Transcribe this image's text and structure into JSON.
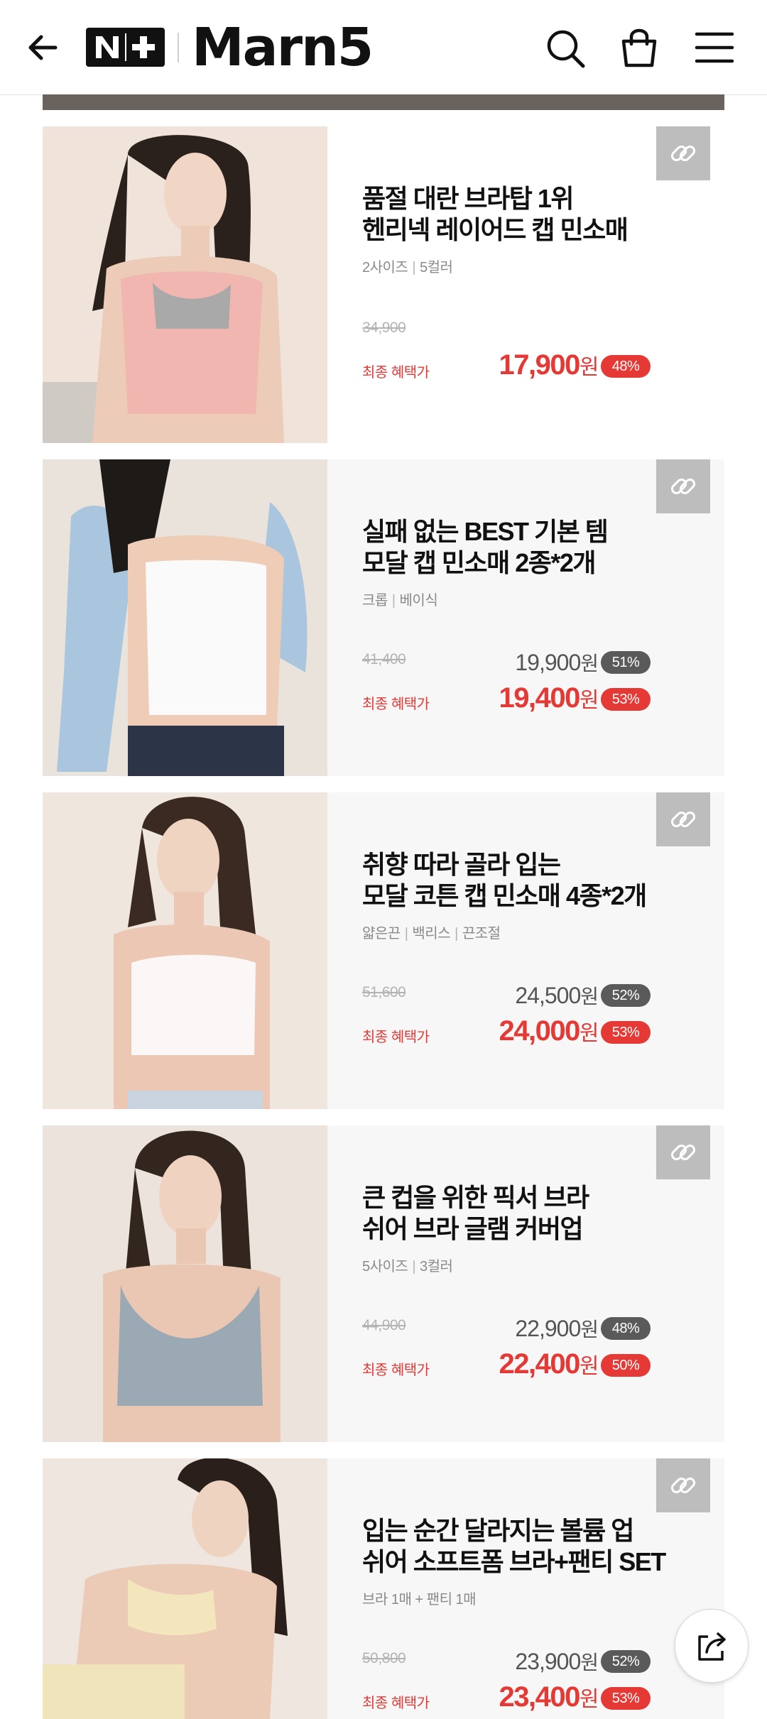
{
  "header": {
    "back_icon": "arrow-left-icon",
    "nplus_logo": "N+",
    "brand": "Marn5",
    "icons": [
      "search-icon",
      "shopping-bag-icon",
      "hamburger-menu-icon"
    ]
  },
  "colors": {
    "accent_red": "#e53935",
    "badge_gray": "#5a5a5a",
    "card_bg": "#f7f7f7",
    "link_button_bg": "#bdbdbd"
  },
  "products": [
    {
      "title_line1": "품절 대란 브라탑 1위",
      "title_line2": "헨리넥 레이어드 캡 민소매",
      "opt1": "2사이즈",
      "opt2": "5컬러",
      "opt3": "",
      "original_price": "34,900",
      "sale_price": "",
      "sale_won": "",
      "sale_discount": "",
      "final_label": "최종 혜택가",
      "final_price": "17,900",
      "final_won": "원",
      "final_discount": "48%"
    },
    {
      "title_line1": "실패 없는 BEST 기본 템",
      "title_line2": "모달 캡 민소매 2종*2개",
      "opt1": "크롭",
      "opt2": "베이식",
      "opt3": "",
      "original_price": "41,400",
      "sale_price": "19,900",
      "sale_won": "원",
      "sale_discount": "51%",
      "final_label": "최종 혜택가",
      "final_price": "19,400",
      "final_won": "원",
      "final_discount": "53%"
    },
    {
      "title_line1": "취향 따라 골라 입는",
      "title_line2": "모달 코튼 캡 민소매 4종*2개",
      "opt1": "얇은끈",
      "opt2": "백리스",
      "opt3": "끈조절",
      "original_price": "51,600",
      "sale_price": "24,500",
      "sale_won": "원",
      "sale_discount": "52%",
      "final_label": "최종 혜택가",
      "final_price": "24,000",
      "final_won": "원",
      "final_discount": "53%"
    },
    {
      "title_line1": "큰 컵을 위한 픽서 브라",
      "title_line2": "쉬어 브라 글램 커버업",
      "opt1": "5사이즈",
      "opt2": "3컬러",
      "opt3": "",
      "original_price": "44,900",
      "sale_price": "22,900",
      "sale_won": "원",
      "sale_discount": "48%",
      "final_label": "최종 혜택가",
      "final_price": "22,400",
      "final_won": "원",
      "final_discount": "50%"
    },
    {
      "title_line1": "입는 순간 달라지는 볼륨 업",
      "title_line2": "쉬어 소프트폼 브라+팬티 SET",
      "opt1": "브라 1매 + 팬티 1매",
      "opt2": "",
      "opt3": "",
      "original_price": "50,800",
      "sale_price": "23,900",
      "sale_won": "원",
      "sale_discount": "52%",
      "final_label": "최종 혜택가",
      "final_price": "23,400",
      "final_won": "원",
      "final_discount": "53%"
    }
  ],
  "share_fab_icon": "share-icon"
}
